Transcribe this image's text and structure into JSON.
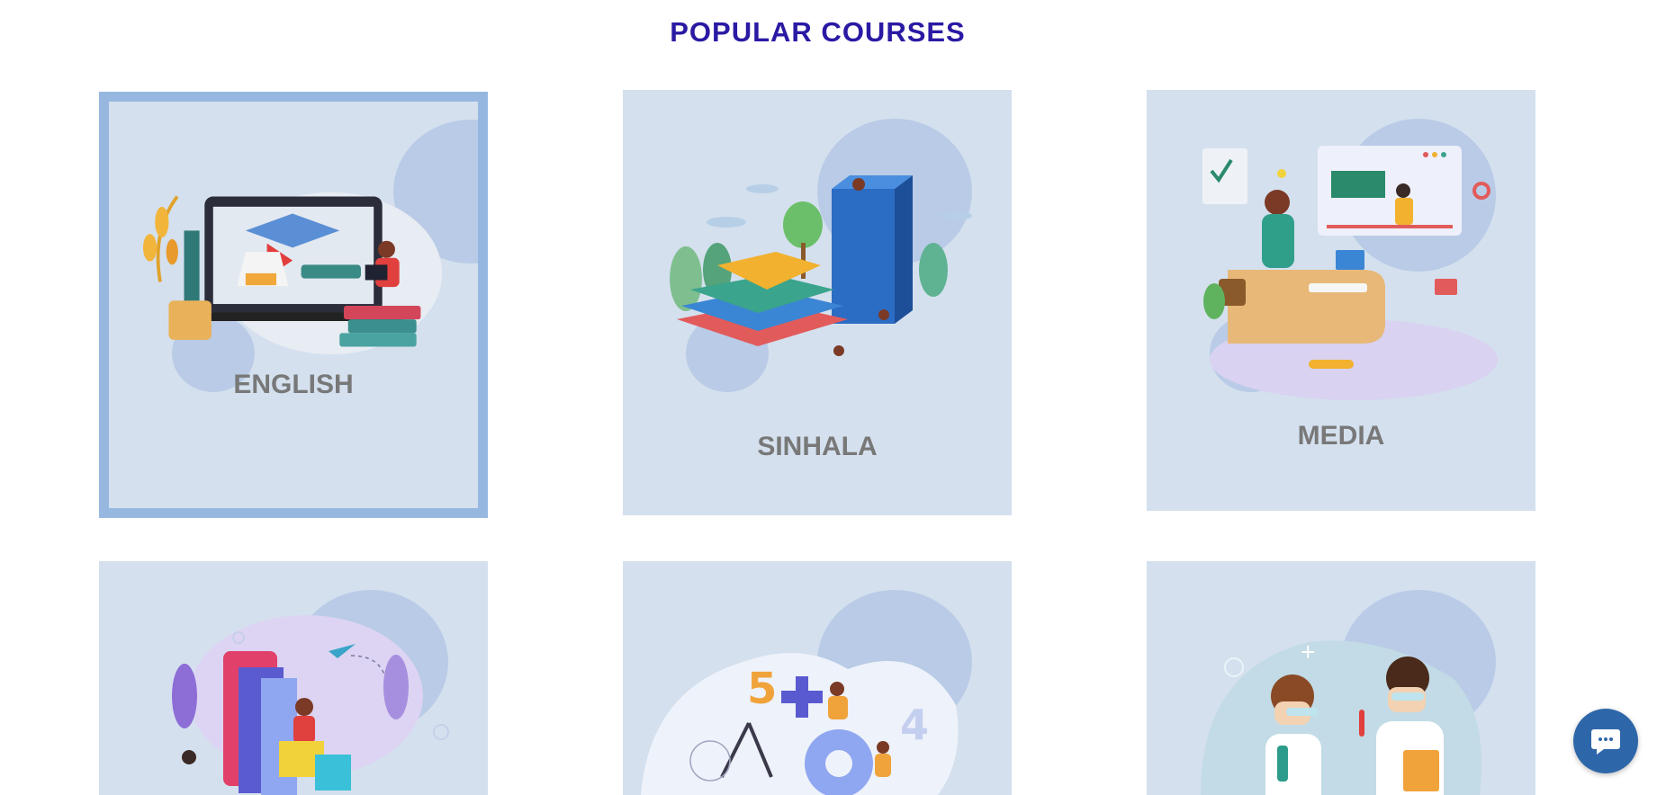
{
  "page": {
    "title": "POPULAR COURSES"
  },
  "courses": [
    {
      "label": "ENGLISH",
      "selected": true
    },
    {
      "label": "SINHALA",
      "selected": false
    },
    {
      "label": "MEDIA",
      "selected": false
    },
    {
      "label": "",
      "selected": false
    },
    {
      "label": "",
      "selected": false
    },
    {
      "label": "",
      "selected": false
    }
  ],
  "colors": {
    "title": "#2a1aa3",
    "card_bg": "#d4e0ee",
    "selected_border": "#96b8e0",
    "chat_button": "#2e67a9"
  },
  "chat": {
    "icon": "chat-bubble-icon"
  }
}
